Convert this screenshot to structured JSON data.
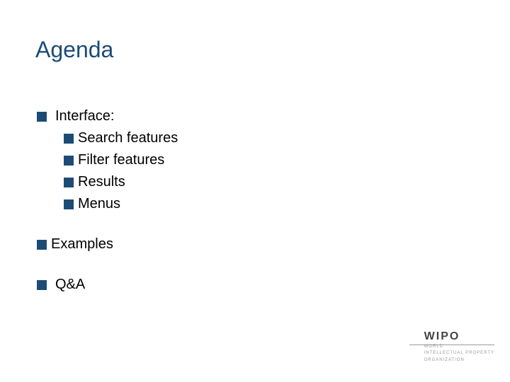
{
  "title": "Agenda",
  "items": {
    "interface": {
      "label": "Interface:",
      "children": {
        "search": "Search features",
        "filter": "Filter features",
        "results": "Results",
        "menus": "Menus"
      }
    },
    "examples": "Examples",
    "qa": "Q&A"
  },
  "footer": {
    "brand": "WIPO",
    "line1": "WORLD",
    "line2": "INTELLECTUAL PROPERTY",
    "line3": "ORGANIZATION"
  }
}
